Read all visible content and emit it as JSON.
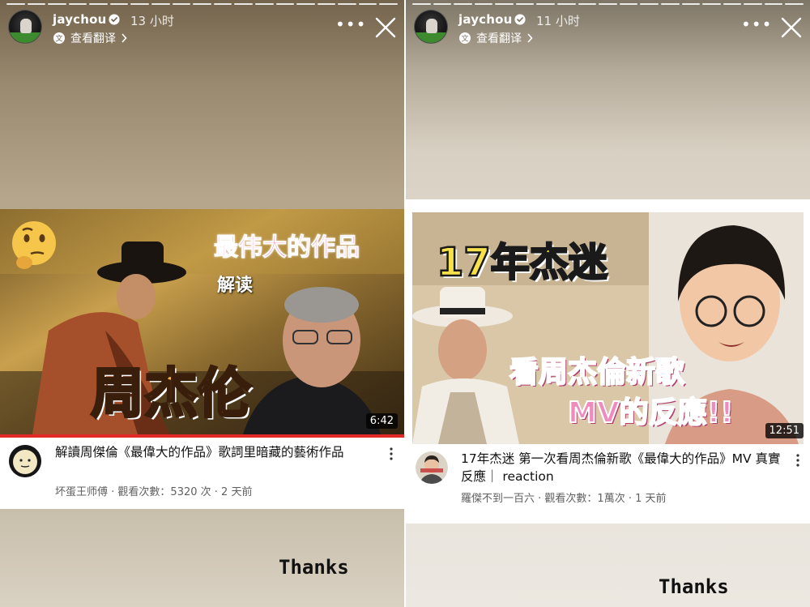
{
  "left_story": {
    "username": "jaychou",
    "time": "13 小时",
    "translate_label": "查看翻译",
    "video": {
      "overlay_title": "最伟大的作品",
      "overlay_sub": "解读",
      "overlay_big": "周杰伦",
      "duration": "6:42",
      "title": "解讀周傑倫《最偉大的作品》歌詞里暗藏的藝術作品",
      "channel": "坏蛋王师傅",
      "views": "觀看次數：5320 次",
      "age": "2 天前"
    },
    "caption": "Thanks"
  },
  "right_story": {
    "username": "jaychou",
    "time": "11 小时",
    "translate_label": "查看翻译",
    "video": {
      "overlay_top": "17年杰迷",
      "overlay_mid": "看周杰倫新歌",
      "overlay_bottom": "MV的反應!!",
      "duration": "12:51",
      "title": "17年杰迷 第一次看周杰倫新歌《最偉大的作品》MV 真實反應｜ reaction",
      "channel": "羅傑不到一百六",
      "views": "觀看次數：1萬次",
      "age": "1 天前"
    },
    "caption": "Thanks"
  },
  "colors": {
    "overlay_pink": "#f04a8c",
    "overlay_yellow": "#f7e14a",
    "overlay_orange": "#f2b04b",
    "progress_red": "#e32828"
  },
  "icons": [
    "verified-badge-icon",
    "translate-icon",
    "chevron-right-icon",
    "more-options-icon",
    "close-icon",
    "kebab-menu-icon",
    "thinking-face-emoji"
  ]
}
